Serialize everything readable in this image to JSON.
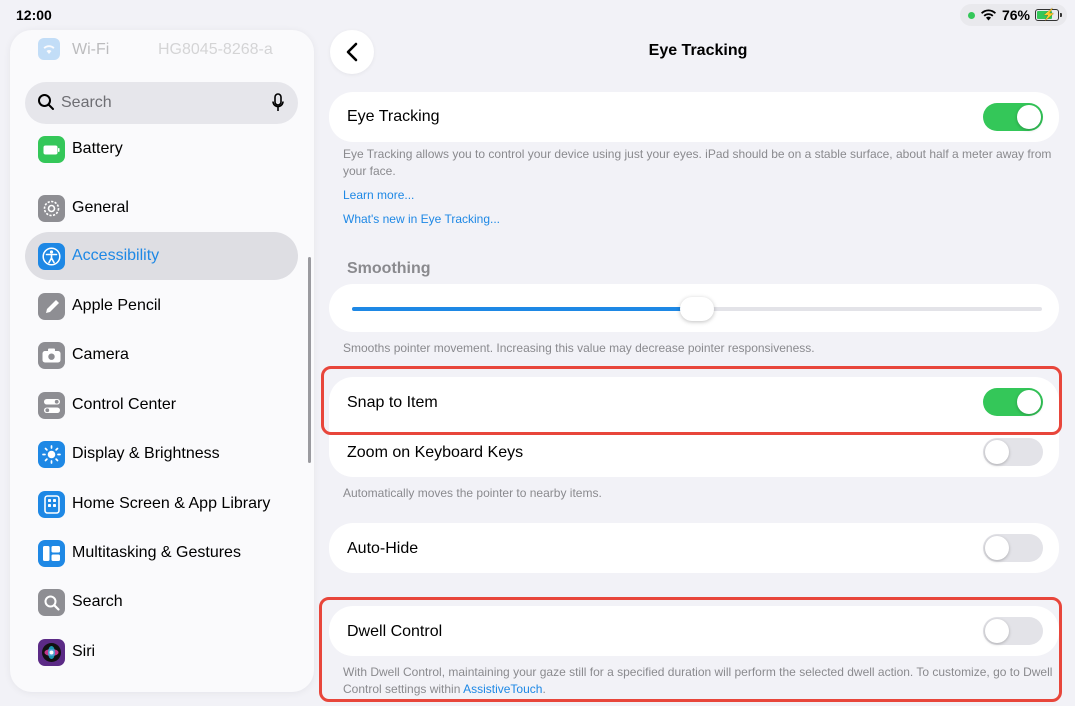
{
  "status": {
    "time": "12:00",
    "battery": "76%"
  },
  "sidebar": {
    "wifi": {
      "label": "Wi-Fi",
      "value": "HG8045-8268-a"
    },
    "search_placeholder": "Search",
    "items": [
      {
        "label": "Battery",
        "icon": "battery-icon",
        "color": "#34c759"
      },
      {
        "label": "General",
        "icon": "gear-icon",
        "color": "#8e8e93"
      },
      {
        "label": "Accessibility",
        "icon": "accessibility-icon",
        "color": "#1e88e5",
        "selected": true
      },
      {
        "label": "Apple Pencil",
        "icon": "pencil-icon",
        "color": "#8e8e93"
      },
      {
        "label": "Camera",
        "icon": "camera-icon",
        "color": "#8e8e93"
      },
      {
        "label": "Control Center",
        "icon": "control-center-icon",
        "color": "#8e8e93"
      },
      {
        "label": "Display & Brightness",
        "icon": "sun-icon",
        "color": "#1e88e5"
      },
      {
        "label": "Home Screen & App Library",
        "icon": "home-screen-icon",
        "color": "#1e88e5"
      },
      {
        "label": "Multitasking & Gestures",
        "icon": "multitasking-icon",
        "color": "#1e88e5"
      },
      {
        "label": "Search",
        "icon": "search-icon",
        "color": "#8e8e93"
      },
      {
        "label": "Siri",
        "icon": "siri-icon",
        "color": "#5b2a86"
      }
    ]
  },
  "main": {
    "title": "Eye Tracking",
    "eye_tracking": {
      "label": "Eye Tracking",
      "on": true,
      "description": "Eye Tracking allows you to control your device using just your eyes. iPad should be on a stable surface, about half a meter away from your face.",
      "learn_more": "Learn more...",
      "whats_new": "What's new in Eye Tracking..."
    },
    "smoothing": {
      "header": "Smoothing",
      "value_fraction": 0.5,
      "description": "Smooths pointer movement. Increasing this value may decrease pointer responsiveness."
    },
    "snap_to_item": {
      "label": "Snap to Item",
      "on": true
    },
    "zoom_keyboard": {
      "label": "Zoom on Keyboard Keys",
      "on": false,
      "description": "Automatically moves the pointer to nearby items."
    },
    "auto_hide": {
      "label": "Auto-Hide",
      "on": false
    },
    "dwell_control": {
      "label": "Dwell Control",
      "on": false,
      "description": "With Dwell Control, maintaining your gaze still for a specified duration will perform the selected dwell action. To customize, go to Dwell Control settings within",
      "link": "AssistiveTouch",
      "description_end": "."
    }
  },
  "colors": {
    "accent": "#1e88e5",
    "toggle_on": "#34c759",
    "highlight": "#e8463b"
  }
}
